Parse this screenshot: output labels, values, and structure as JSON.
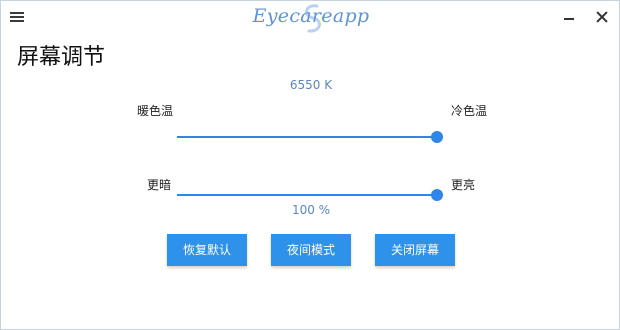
{
  "app": {
    "title": "Eyecareapp",
    "brand_color": "#5d93d7"
  },
  "titlebar": {
    "menu_icon": "hamburger-menu-icon",
    "minimize_icon": "minimize-icon",
    "close_icon": "close-icon"
  },
  "page": {
    "title": "屏幕调节"
  },
  "color_temperature": {
    "value_text": "6550 K",
    "value": 6550,
    "position_fraction": 1.0,
    "warm_label": "暖色温",
    "cool_label": "冷色温"
  },
  "brightness": {
    "value_text": "100 %",
    "value": 100,
    "position_fraction": 1.0,
    "dark_label": "更暗",
    "bright_label": "更亮"
  },
  "buttons": {
    "reset": "恢复默认",
    "night_mode": "夜间模式",
    "close_screen": "关闭屏幕"
  },
  "colors": {
    "accent": "#2f86e8",
    "button": "#2f92ea",
    "value_text": "#5a86c5"
  }
}
